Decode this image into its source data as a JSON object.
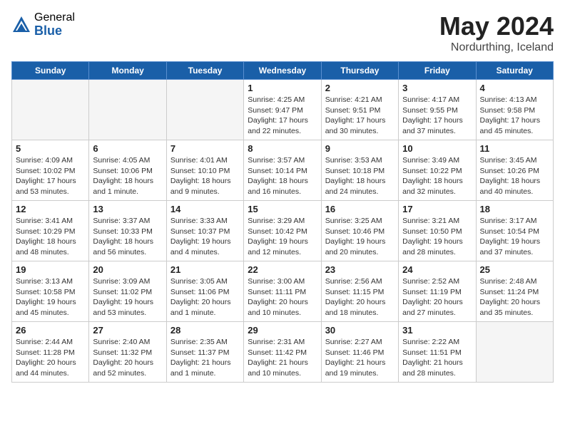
{
  "header": {
    "logo_general": "General",
    "logo_blue": "Blue",
    "title": "May 2024",
    "location": "Nordurthing, Iceland"
  },
  "weekdays": [
    "Sunday",
    "Monday",
    "Tuesday",
    "Wednesday",
    "Thursday",
    "Friday",
    "Saturday"
  ],
  "weeks": [
    [
      {
        "day": "",
        "info": ""
      },
      {
        "day": "",
        "info": ""
      },
      {
        "day": "",
        "info": ""
      },
      {
        "day": "1",
        "info": "Sunrise: 4:25 AM\nSunset: 9:47 PM\nDaylight: 17 hours\nand 22 minutes."
      },
      {
        "day": "2",
        "info": "Sunrise: 4:21 AM\nSunset: 9:51 PM\nDaylight: 17 hours\nand 30 minutes."
      },
      {
        "day": "3",
        "info": "Sunrise: 4:17 AM\nSunset: 9:55 PM\nDaylight: 17 hours\nand 37 minutes."
      },
      {
        "day": "4",
        "info": "Sunrise: 4:13 AM\nSunset: 9:58 PM\nDaylight: 17 hours\nand 45 minutes."
      }
    ],
    [
      {
        "day": "5",
        "info": "Sunrise: 4:09 AM\nSunset: 10:02 PM\nDaylight: 17 hours\nand 53 minutes."
      },
      {
        "day": "6",
        "info": "Sunrise: 4:05 AM\nSunset: 10:06 PM\nDaylight: 18 hours\nand 1 minute."
      },
      {
        "day": "7",
        "info": "Sunrise: 4:01 AM\nSunset: 10:10 PM\nDaylight: 18 hours\nand 9 minutes."
      },
      {
        "day": "8",
        "info": "Sunrise: 3:57 AM\nSunset: 10:14 PM\nDaylight: 18 hours\nand 16 minutes."
      },
      {
        "day": "9",
        "info": "Sunrise: 3:53 AM\nSunset: 10:18 PM\nDaylight: 18 hours\nand 24 minutes."
      },
      {
        "day": "10",
        "info": "Sunrise: 3:49 AM\nSunset: 10:22 PM\nDaylight: 18 hours\nand 32 minutes."
      },
      {
        "day": "11",
        "info": "Sunrise: 3:45 AM\nSunset: 10:26 PM\nDaylight: 18 hours\nand 40 minutes."
      }
    ],
    [
      {
        "day": "12",
        "info": "Sunrise: 3:41 AM\nSunset: 10:29 PM\nDaylight: 18 hours\nand 48 minutes."
      },
      {
        "day": "13",
        "info": "Sunrise: 3:37 AM\nSunset: 10:33 PM\nDaylight: 18 hours\nand 56 minutes."
      },
      {
        "day": "14",
        "info": "Sunrise: 3:33 AM\nSunset: 10:37 PM\nDaylight: 19 hours\nand 4 minutes."
      },
      {
        "day": "15",
        "info": "Sunrise: 3:29 AM\nSunset: 10:42 PM\nDaylight: 19 hours\nand 12 minutes."
      },
      {
        "day": "16",
        "info": "Sunrise: 3:25 AM\nSunset: 10:46 PM\nDaylight: 19 hours\nand 20 minutes."
      },
      {
        "day": "17",
        "info": "Sunrise: 3:21 AM\nSunset: 10:50 PM\nDaylight: 19 hours\nand 28 minutes."
      },
      {
        "day": "18",
        "info": "Sunrise: 3:17 AM\nSunset: 10:54 PM\nDaylight: 19 hours\nand 37 minutes."
      }
    ],
    [
      {
        "day": "19",
        "info": "Sunrise: 3:13 AM\nSunset: 10:58 PM\nDaylight: 19 hours\nand 45 minutes."
      },
      {
        "day": "20",
        "info": "Sunrise: 3:09 AM\nSunset: 11:02 PM\nDaylight: 19 hours\nand 53 minutes."
      },
      {
        "day": "21",
        "info": "Sunrise: 3:05 AM\nSunset: 11:06 PM\nDaylight: 20 hours\nand 1 minute."
      },
      {
        "day": "22",
        "info": "Sunrise: 3:00 AM\nSunset: 11:11 PM\nDaylight: 20 hours\nand 10 minutes."
      },
      {
        "day": "23",
        "info": "Sunrise: 2:56 AM\nSunset: 11:15 PM\nDaylight: 20 hours\nand 18 minutes."
      },
      {
        "day": "24",
        "info": "Sunrise: 2:52 AM\nSunset: 11:19 PM\nDaylight: 20 hours\nand 27 minutes."
      },
      {
        "day": "25",
        "info": "Sunrise: 2:48 AM\nSunset: 11:24 PM\nDaylight: 20 hours\nand 35 minutes."
      }
    ],
    [
      {
        "day": "26",
        "info": "Sunrise: 2:44 AM\nSunset: 11:28 PM\nDaylight: 20 hours\nand 44 minutes."
      },
      {
        "day": "27",
        "info": "Sunrise: 2:40 AM\nSunset: 11:32 PM\nDaylight: 20 hours\nand 52 minutes."
      },
      {
        "day": "28",
        "info": "Sunrise: 2:35 AM\nSunset: 11:37 PM\nDaylight: 21 hours\nand 1 minute."
      },
      {
        "day": "29",
        "info": "Sunrise: 2:31 AM\nSunset: 11:42 PM\nDaylight: 21 hours\nand 10 minutes."
      },
      {
        "day": "30",
        "info": "Sunrise: 2:27 AM\nSunset: 11:46 PM\nDaylight: 21 hours\nand 19 minutes."
      },
      {
        "day": "31",
        "info": "Sunrise: 2:22 AM\nSunset: 11:51 PM\nDaylight: 21 hours\nand 28 minutes."
      },
      {
        "day": "",
        "info": ""
      }
    ]
  ]
}
